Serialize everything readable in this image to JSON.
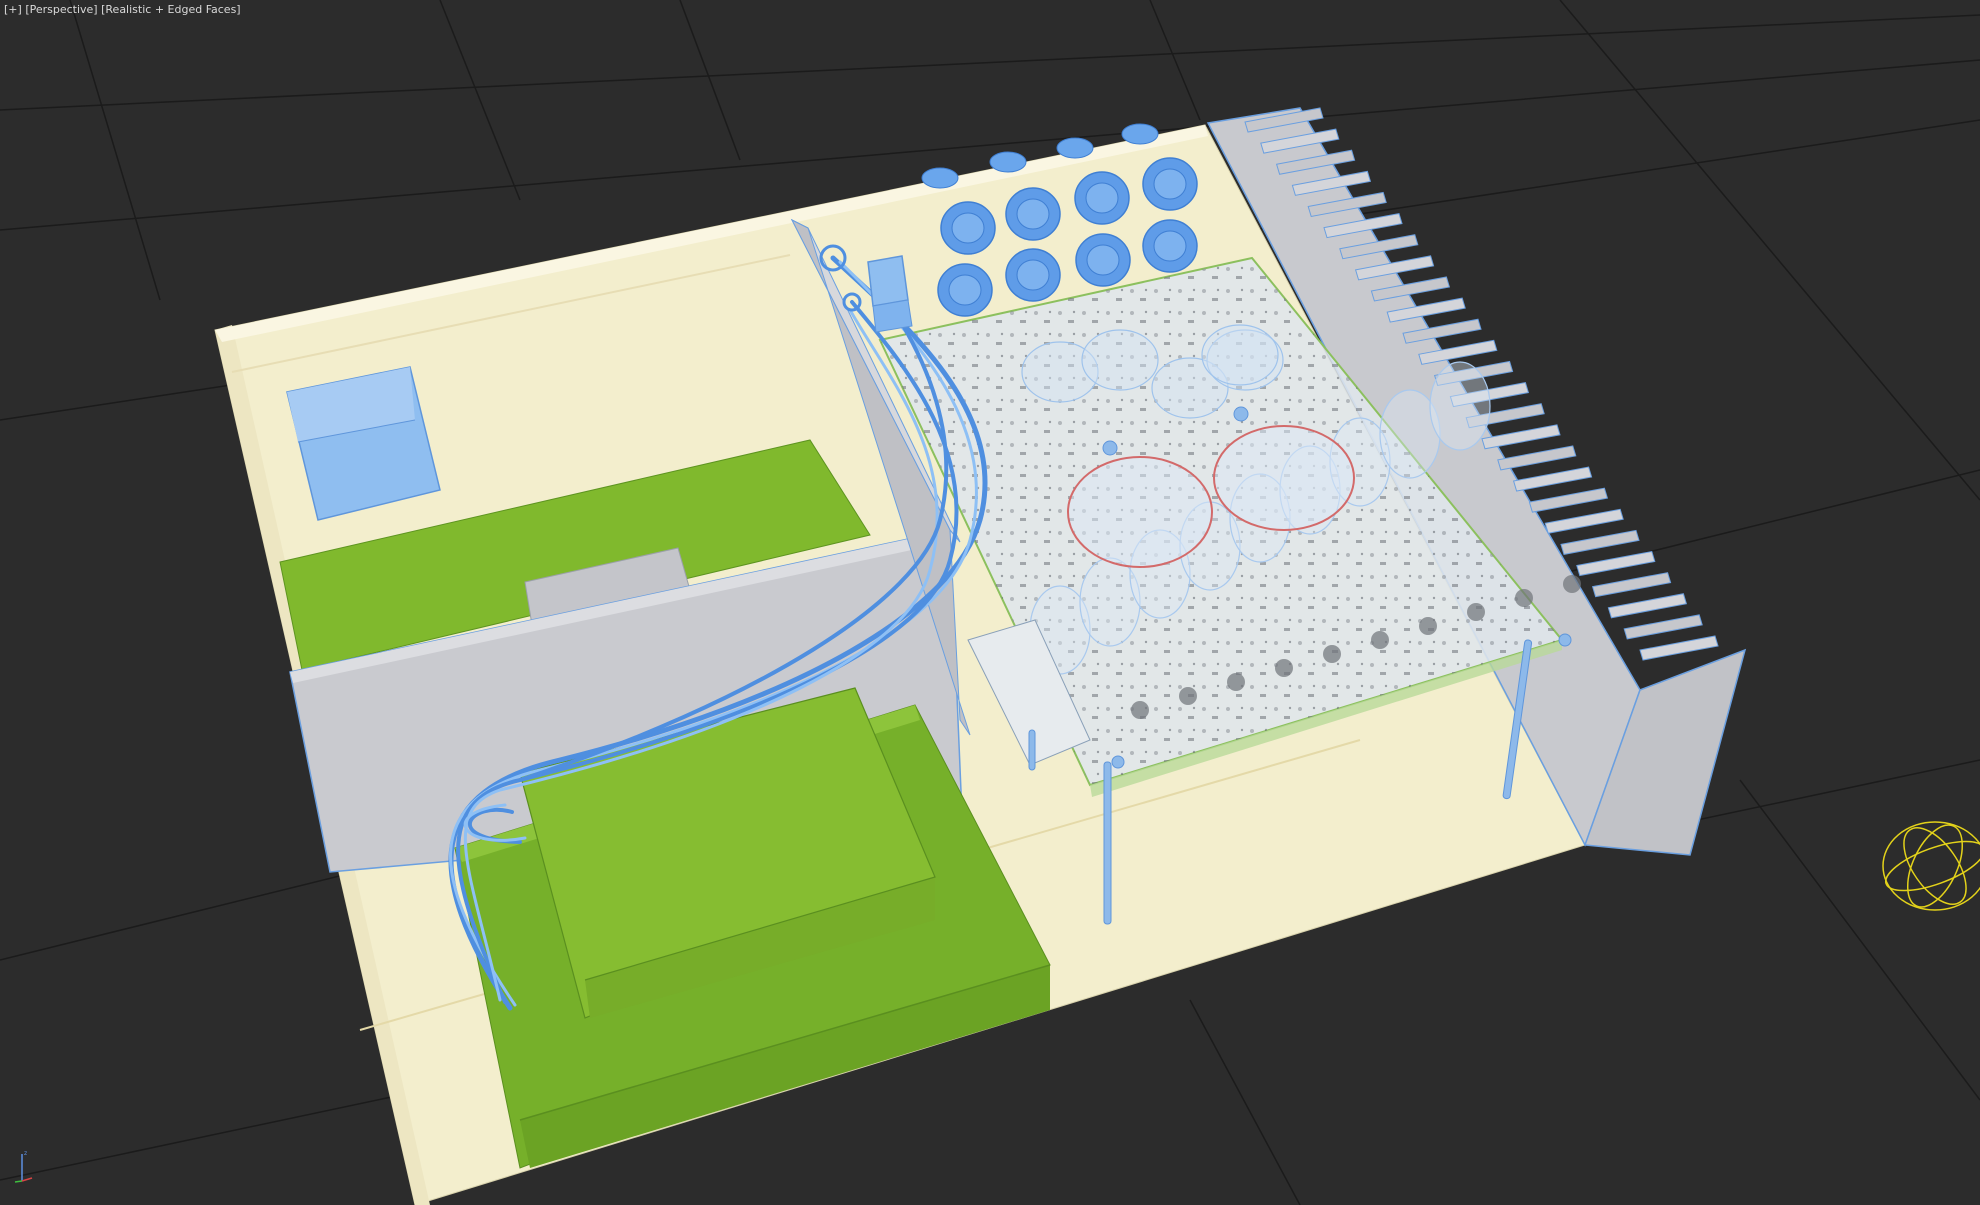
{
  "viewport": {
    "label_menu": "[+]",
    "label_view": "[Perspective]",
    "label_shading": "[Realistic + Edged Faces]"
  },
  "colors": {
    "background": "#2c2c2c",
    "grid": "#1c1c1c",
    "enclosure": "#f4efcf",
    "wall": "#c9cacf",
    "pcb_green": "#7fb92e",
    "selection_blue": "#7fb3ee",
    "light_gizmo": "#e3d21a"
  },
  "scene": {
    "objects": [
      "enclosure",
      "divider-wall",
      "heatsink",
      "transformer",
      "power-board",
      "amplifier-pcb",
      "capacitor-array",
      "wire-harness",
      "standoffs",
      "omni-light"
    ]
  }
}
